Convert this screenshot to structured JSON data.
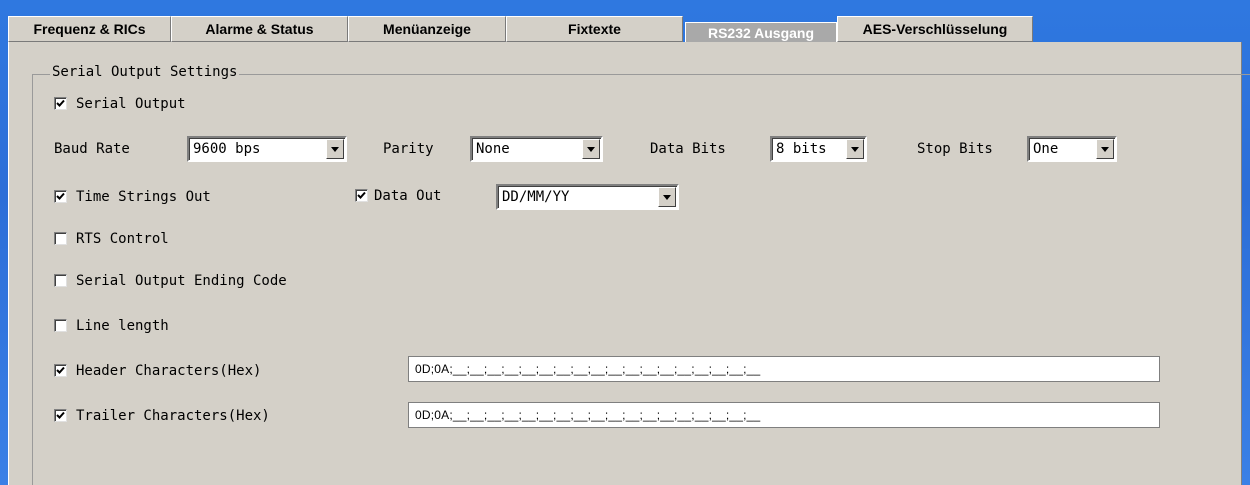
{
  "tabs": [
    {
      "label": "Frequenz & RICs"
    },
    {
      "label": "Alarme & Status"
    },
    {
      "label": "Menüanzeige"
    },
    {
      "label": "Fixtexte"
    },
    {
      "label": "RS232 Ausgang",
      "selected": true
    },
    {
      "label": "AES-Verschlüsselung"
    }
  ],
  "group": {
    "title": "Serial Output Settings"
  },
  "serial_output": {
    "label": "Serial Output",
    "checked": true
  },
  "baud_rate": {
    "label": "Baud Rate",
    "value": "9600 bps"
  },
  "parity": {
    "label": "Parity",
    "value": "None"
  },
  "data_bits": {
    "label": "Data Bits",
    "value": "8 bits"
  },
  "stop_bits": {
    "label": "Stop Bits",
    "value": "One"
  },
  "time_strings_out": {
    "label": "Time Strings Out",
    "checked": true
  },
  "data_out": {
    "label": "Data Out",
    "checked": true,
    "format": "DD/MM/YY"
  },
  "rts_control": {
    "label": "RTS Control",
    "checked": false
  },
  "serial_output_ending_code": {
    "label": "Serial Output Ending Code",
    "checked": false
  },
  "line_length": {
    "label": "Line length",
    "checked": false
  },
  "header_characters": {
    "label": "Header Characters(Hex)",
    "checked": true,
    "value": "0D;0A;__;__;__;__;__;__;__;__;__;__;__;__;__;__;__;__;__;__"
  },
  "trailer_characters": {
    "label": "Trailer Characters(Hex)",
    "checked": true,
    "value": "0D;0A;__;__;__;__;__;__;__;__;__;__;__;__;__;__;__;__;__;__"
  },
  "colors": {
    "tab_bg": "#d4d0c8",
    "selected_tab_bg": "#a9a9a9",
    "desktop_blue": "#2f78e0"
  }
}
